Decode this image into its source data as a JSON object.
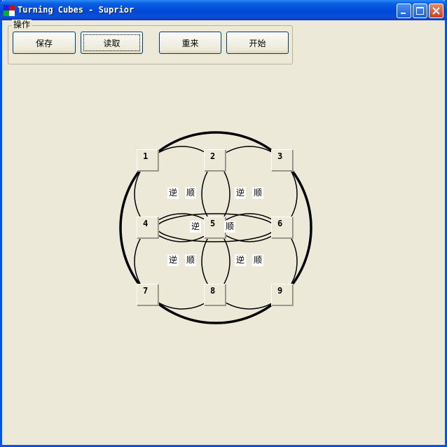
{
  "window": {
    "title": "Turning Cubes - Suprior",
    "icon": "app-icon"
  },
  "controls": {
    "group_label": "操作",
    "buttons": {
      "save": "保存",
      "load": "读取",
      "restart": "重来",
      "start": "开始"
    },
    "focused": "load"
  },
  "board": {
    "cells": [
      "1",
      "2",
      "3",
      "4",
      "5",
      "6",
      "7",
      "8",
      "9"
    ],
    "rotations": {
      "counterclockwise": "逆",
      "clockwise": "顺"
    }
  },
  "colors": {
    "titlebar": "#0a5ee0",
    "face": "#ece9d8",
    "close_button": "#c8401c",
    "ring_line": "#000000"
  }
}
